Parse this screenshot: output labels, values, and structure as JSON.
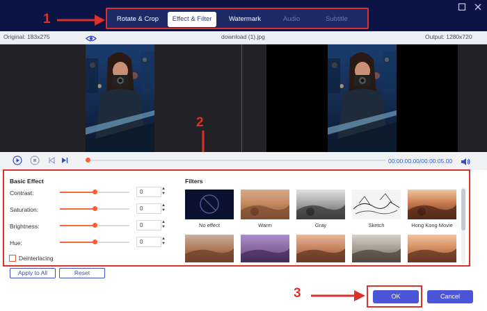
{
  "window": {
    "restore_icon": "restore-icon",
    "close_icon": "close-icon"
  },
  "tabs": [
    {
      "label": "Rotate & Crop",
      "state": "normal"
    },
    {
      "label": "Effect & Filter",
      "state": "active"
    },
    {
      "label": "Watermark",
      "state": "normal"
    },
    {
      "label": "Audio",
      "state": "disabled"
    },
    {
      "label": "Subtitle",
      "state": "disabled"
    }
  ],
  "annotations": {
    "one": "1",
    "two": "2",
    "three": "3"
  },
  "info": {
    "original": "Original: 183x275",
    "filename": "download (1).jpg",
    "output": "Output: 1280x720"
  },
  "playback": {
    "timecode": "00:00:00.00/00:00:05.00",
    "progress_fraction": 0.0
  },
  "basic_effect": {
    "title": "Basic Effect",
    "sliders": [
      {
        "label": "Contrast:",
        "value": "0",
        "fraction": 0.5
      },
      {
        "label": "Saturation:",
        "value": "0",
        "fraction": 0.5
      },
      {
        "label": "Brightness:",
        "value": "0",
        "fraction": 0.5
      },
      {
        "label": "Hue:",
        "value": "0",
        "fraction": 0.5
      }
    ],
    "deinterlacing_label": "Deinterlacing",
    "deinterlacing_checked": false
  },
  "filters": {
    "title": "Filters",
    "items": [
      {
        "label": "No effect"
      },
      {
        "label": "Warm"
      },
      {
        "label": "Gray"
      },
      {
        "label": "Sketch"
      },
      {
        "label": "Hong Kong Movie"
      },
      {
        "label": ""
      },
      {
        "label": ""
      },
      {
        "label": ""
      },
      {
        "label": ""
      },
      {
        "label": ""
      }
    ]
  },
  "buttons": {
    "apply_all": "Apply to All",
    "reset": "Reset",
    "ok": "OK",
    "cancel": "Cancel"
  },
  "colors": {
    "accent": "#4b55d6",
    "annotation": "#d9312b",
    "slider": "#ff5b2e",
    "title_bar": "#0c1446"
  }
}
